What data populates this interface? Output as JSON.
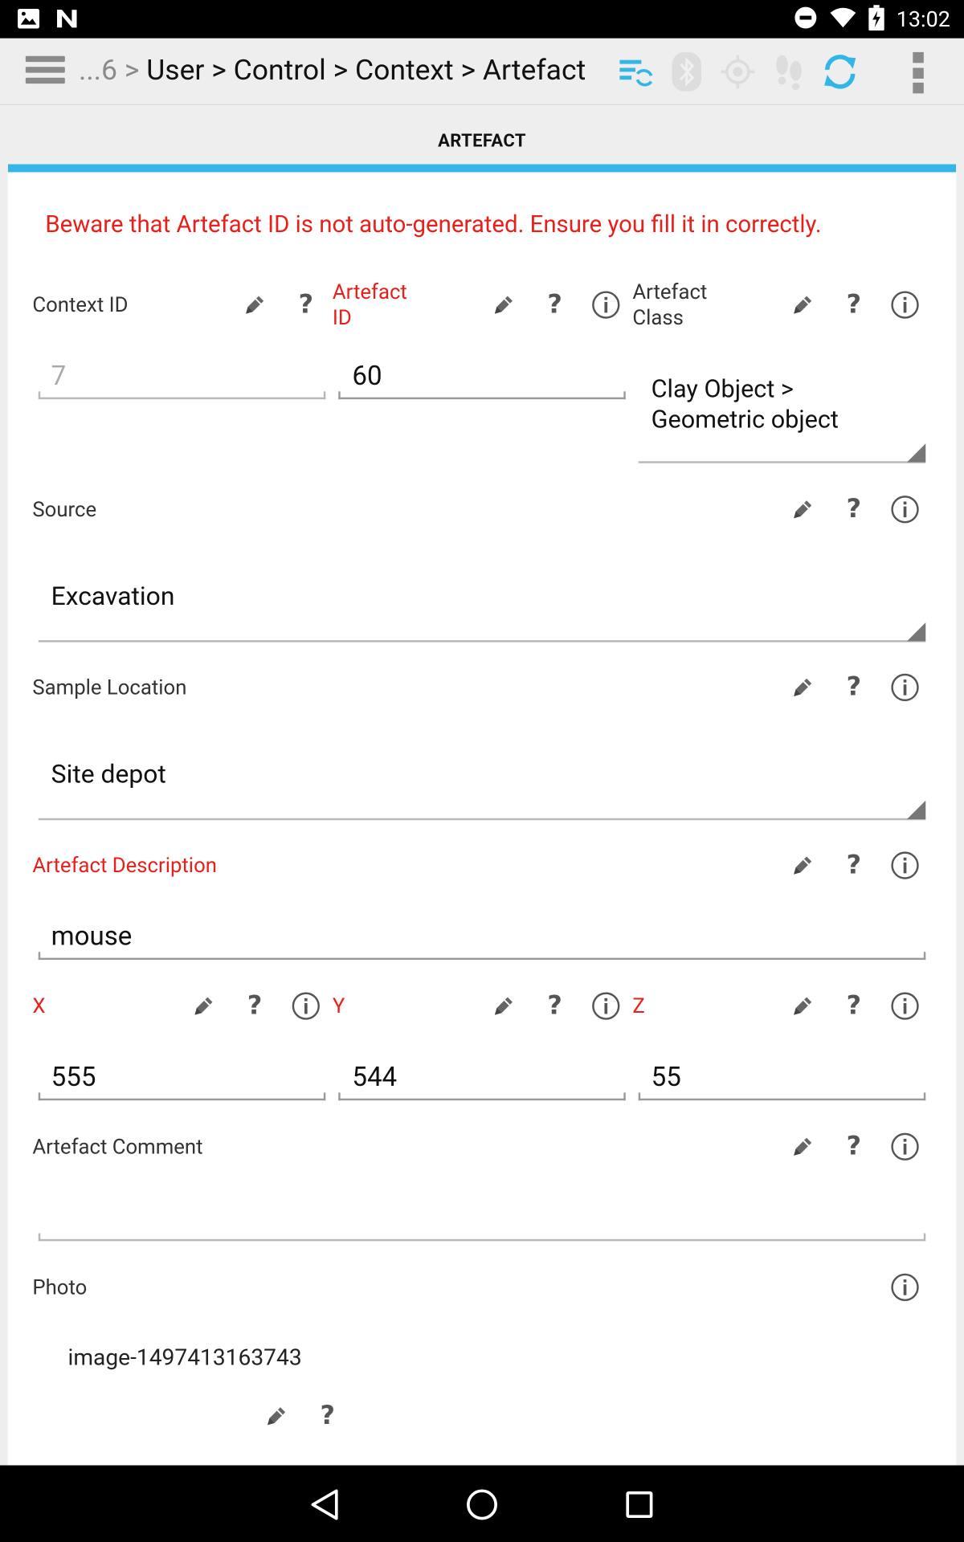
{
  "status_bar": {
    "time": "13:02",
    "left_icons": [
      "image-icon",
      "n-logo-icon"
    ],
    "right_icons": [
      "do-not-disturb-icon",
      "wifi-icon",
      "battery-charging-icon"
    ]
  },
  "app_bar": {
    "breadcrumb_prefix": "...6 >",
    "breadcrumb_path": "User > Control > Context > Artefact",
    "icons": [
      "sync-list-icon",
      "bluetooth-icon",
      "gps-icon",
      "footsteps-icon",
      "refresh-icon"
    ],
    "accent_color": "#33b5e5"
  },
  "tab": {
    "label": "ARTEFACT"
  },
  "warning": "Beware that Artefact ID is not auto-generated. Ensure you fill it in correctly.",
  "fields": {
    "context_id": {
      "label": "Context ID",
      "value": "7"
    },
    "artefact_id": {
      "label": "Artefact ID",
      "label_line1": "Artefact",
      "label_line2": "ID",
      "value": "60"
    },
    "artefact_class": {
      "label_line1": "Artefact",
      "label_line2": "Class",
      "value_line1": "Clay Object >",
      "value_line2": "Geometric object"
    },
    "source": {
      "label": "Source",
      "value": "Excavation"
    },
    "sample_location": {
      "label": "Sample Location",
      "value": "Site depot"
    },
    "artefact_description": {
      "label": "Artefact Description",
      "value": "mouse"
    },
    "x": {
      "label": "X",
      "value": "555"
    },
    "y": {
      "label": "Y",
      "value": "544"
    },
    "z": {
      "label": "Z",
      "value": "55"
    },
    "artefact_comment": {
      "label": "Artefact Comment",
      "value": ""
    },
    "photo": {
      "label": "Photo",
      "value": "image-1497413163743"
    }
  },
  "colors": {
    "required_label": "#e8201a",
    "tab_indicator": "#33b5e5"
  },
  "nav_bar": {
    "icons": [
      "back-icon",
      "home-icon",
      "recents-icon"
    ]
  }
}
